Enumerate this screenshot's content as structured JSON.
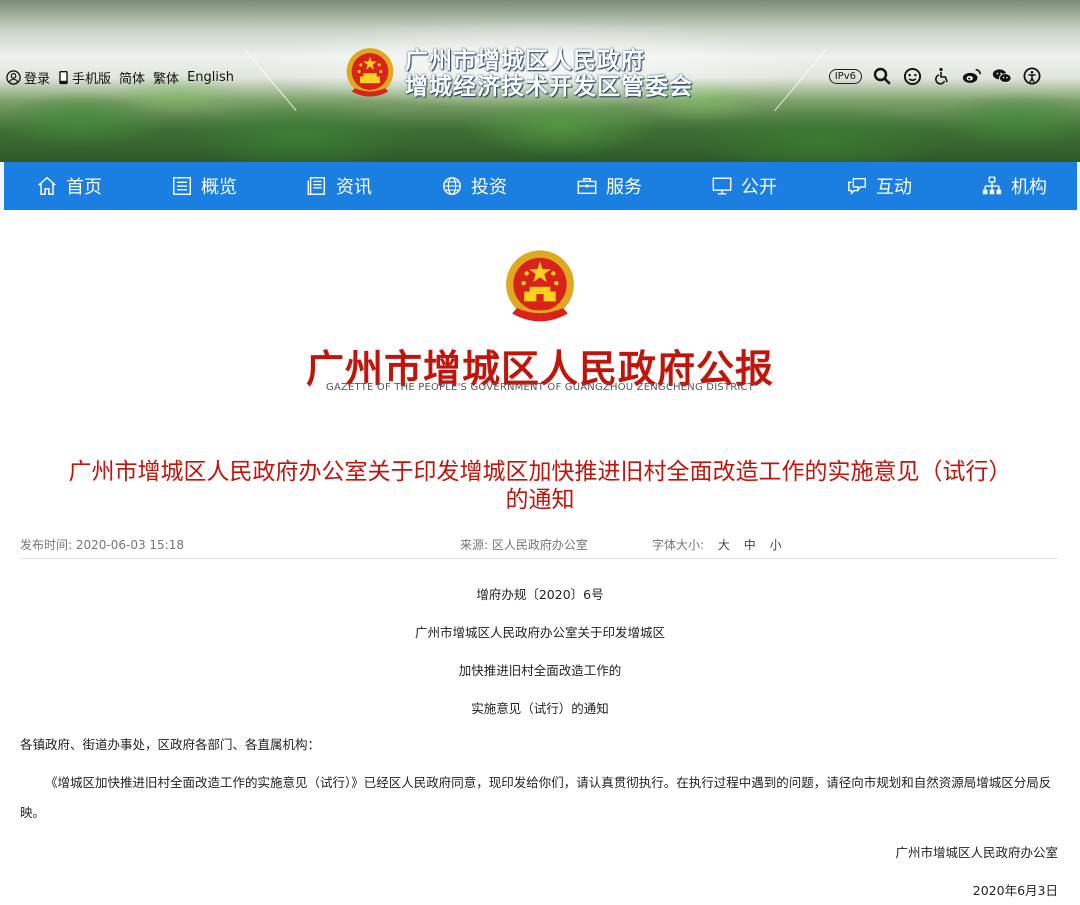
{
  "topbar": {
    "login": "登录",
    "mobile": "手机版",
    "simplified": "简体",
    "traditional": "繁体",
    "english": "English",
    "ipv6": "IPv6",
    "right_icons": [
      "search-icon",
      "accessibility-face-icon",
      "wheelchair-icon",
      "weibo-icon",
      "wechat-icon",
      "elder-care-icon"
    ]
  },
  "header": {
    "title_line1": "广州市增城区人民政府",
    "title_line2": "增城经济技术开发区管委会"
  },
  "nav": {
    "items": [
      {
        "label": "首页",
        "icon": "home-icon"
      },
      {
        "label": "概览",
        "icon": "list-icon"
      },
      {
        "label": "资讯",
        "icon": "news-icon"
      },
      {
        "label": "投资",
        "icon": "globe-icon"
      },
      {
        "label": "服务",
        "icon": "briefcase-icon"
      },
      {
        "label": "公开",
        "icon": "monitor-icon"
      },
      {
        "label": "互动",
        "icon": "chat-icon"
      },
      {
        "label": "机构",
        "icon": "org-chart-icon"
      }
    ]
  },
  "gazette": {
    "title": "广州市增城区人民政府公报",
    "subtitle": "GAZETTE OF THE PEOPLE'S GOVERNMENT OF GUANGZHOU ZENGCHENG DISTRICT"
  },
  "article": {
    "headline_line1": "广州市增城区人民政府办公室关于印发增城区加快推进旧村全面改造工作的实施意见（试行）",
    "headline_line2": "的通知",
    "publish_time": "发布时间: 2020-06-03 15:18",
    "source": "来源: 区人民政府办公室",
    "font_size_label": "字体大小:",
    "font_size_options": [
      "大",
      "中",
      "小"
    ],
    "doc_number": "增府办规〔2020〕6号",
    "doc_title_lines": [
      "广州市增城区人民政府办公室关于印发增城区",
      "加快推进旧村全面改造工作的",
      "实施意见（试行）的通知"
    ],
    "salutation": "各镇政府、街道办事处，区政府各部门、各直属机构：",
    "body": "《增城区加快推进旧村全面改造工作的实施意见（试行）》已经区人民政府同意，现印发给你们，请认真贯彻执行。在执行过程中遇到的问题，请径向市规划和自然资源局增城区分局反映。",
    "signature": "广州市增城区人民政府办公室",
    "date": "2020年6月3日"
  }
}
